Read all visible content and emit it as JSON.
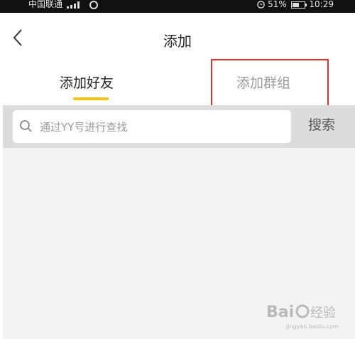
{
  "status_bar": {
    "carrier": "中国联通",
    "battery": "51%",
    "time": "10:29"
  },
  "nav": {
    "title": "添加"
  },
  "tabs": [
    {
      "label": "添加好友",
      "active": true
    },
    {
      "label": "添加群组",
      "active": false
    }
  ],
  "search": {
    "placeholder": "通过YY号进行查找",
    "button_label": "搜索"
  },
  "watermark": {
    "text": "Bai 经验",
    "subtext": "jingyan.baidu.com"
  },
  "colors": {
    "accent_underline": "#f1c40f",
    "highlight_box": "#e0312c"
  }
}
